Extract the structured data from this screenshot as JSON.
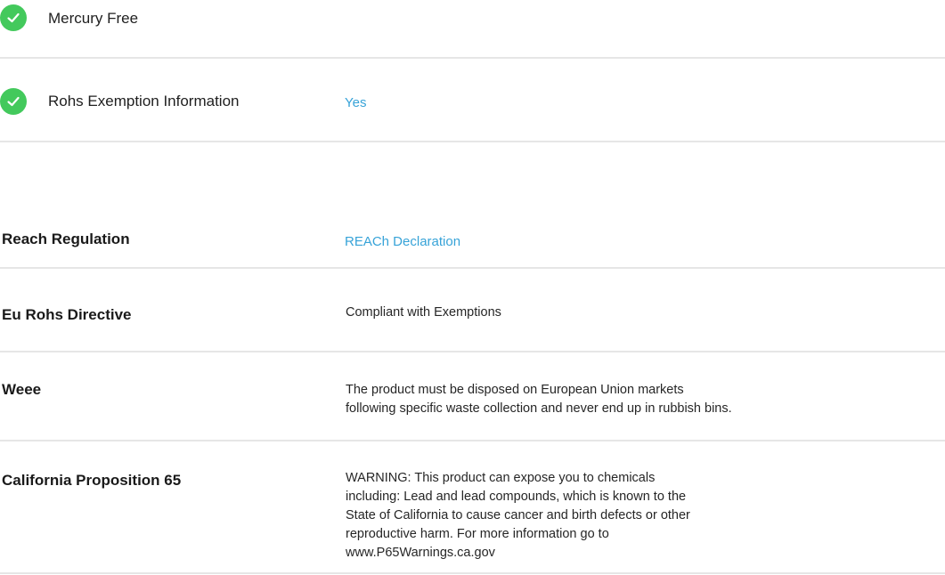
{
  "features": [
    {
      "icon": "check-circle-icon",
      "label": "Mercury Free",
      "value": ""
    },
    {
      "icon": "check-circle-icon",
      "label": "Rohs Exemption Information",
      "value": "Yes"
    }
  ],
  "regulations": [
    {
      "label": "Reach Regulation",
      "value": "REACh Declaration",
      "is_link": true
    },
    {
      "label": "Eu Rohs Directive",
      "value": "Compliant with Exemptions",
      "is_link": false
    },
    {
      "label": "Weee",
      "value": "The product must be disposed on European Union markets following specific waste collection and never end up in rubbish bins.",
      "is_link": false
    },
    {
      "label": "California Proposition 65",
      "value": "WARNING: This product can expose you to chemicals including: Lead and lead compounds, which is known to the State of California to cause cancer and birth defects or other reproductive harm. For more information go to www.P65Warnings.ca.gov",
      "is_link": false
    }
  ],
  "colors": {
    "check_green": "#43c95c",
    "link_blue": "#37a3d8",
    "divider_gray": "#e6e6e6"
  }
}
